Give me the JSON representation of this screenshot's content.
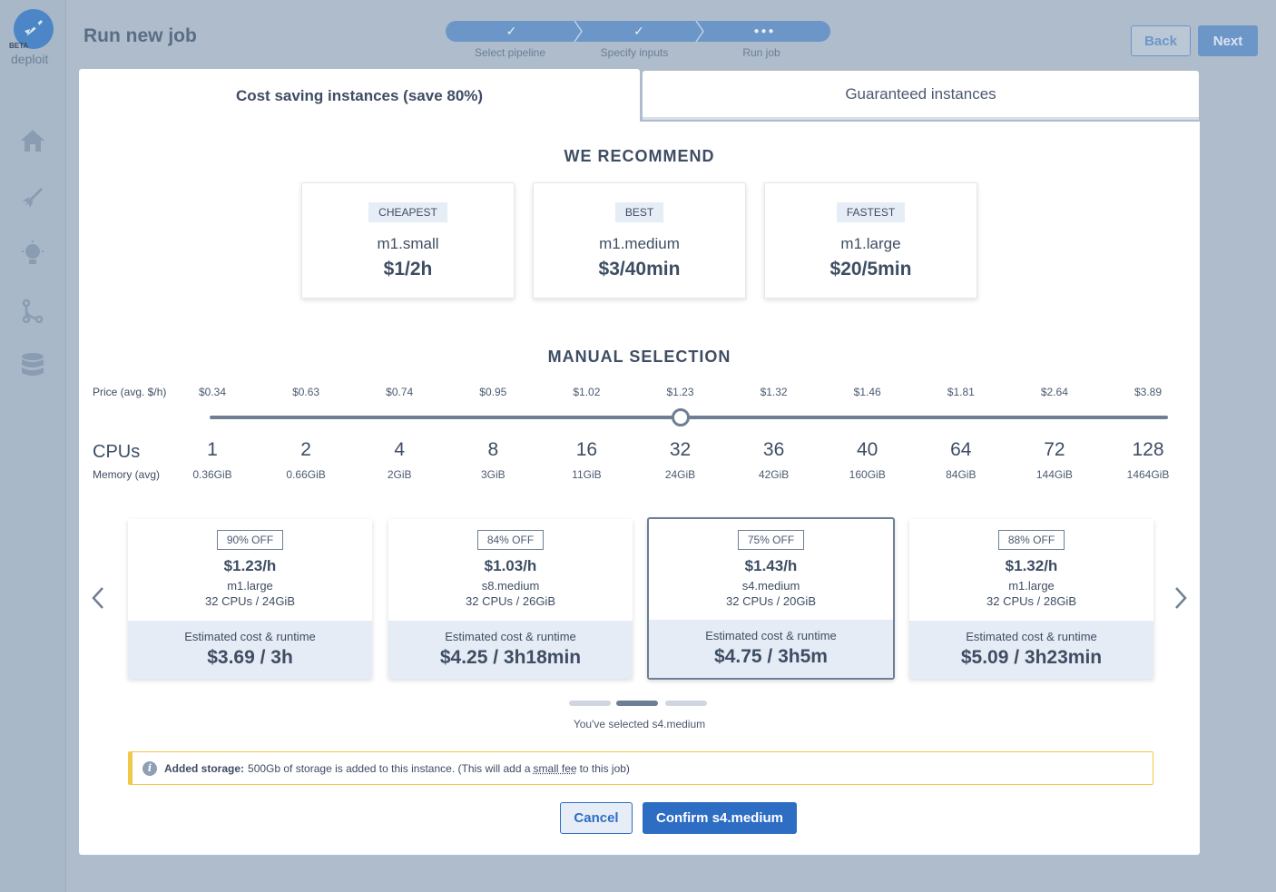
{
  "app": {
    "badge": "BETA",
    "name": "deploit"
  },
  "header": {
    "title": "Run new job",
    "steps": [
      {
        "label": "Select pipeline",
        "state": "done"
      },
      {
        "label": "Specify inputs",
        "state": "done"
      },
      {
        "label": "Run job",
        "state": "current"
      }
    ],
    "back_label": "Back",
    "next_label": "Next"
  },
  "tabs": [
    {
      "label": "Cost saving instances (save 80%)",
      "active": true
    },
    {
      "label": "Guaranteed instances",
      "active": false
    }
  ],
  "recommend": {
    "title": "WE RECOMMEND",
    "cards": [
      {
        "badge": "CHEAPEST",
        "name": "m1.small",
        "price": "$1/2h"
      },
      {
        "badge": "BEST",
        "name": "m1.medium",
        "price": "$3/40min"
      },
      {
        "badge": "FASTEST",
        "name": "m1.large",
        "price": "$20/5min"
      }
    ]
  },
  "manual": {
    "title": "MANUAL SELECTION",
    "price_label": "Price (avg. $/h)",
    "cpu_label": "CPUs",
    "memory_label": "Memory (avg)",
    "prices": [
      "$0.34",
      "$0.63",
      "$0.74",
      "$0.95",
      "$1.02",
      "$1.23",
      "$1.32",
      "$1.46",
      "$1.81",
      "$2.64",
      "$3.89"
    ],
    "cpus": [
      "1",
      "2",
      "4",
      "8",
      "16",
      "32",
      "36",
      "40",
      "64",
      "72",
      "128"
    ],
    "memory": [
      "0.36GiB",
      "0.66GiB",
      "2GiB",
      "3GiB",
      "11GiB",
      "24GiB",
      "42GiB",
      "160GiB",
      "84GiB",
      "144GiB",
      "1464GiB"
    ],
    "selected_index": 5
  },
  "instances": {
    "cards": [
      {
        "discount": "90% OFF",
        "price": "$1.23/h",
        "type": "m1.large",
        "spec": "32 CPUs / 24GiB",
        "est_label": "Estimated cost & runtime",
        "est": "$3.69 / 3h",
        "selected": false
      },
      {
        "discount": "84% OFF",
        "price": "$1.03/h",
        "type": "s8.medium",
        "spec": "32 CPUs / 26GiB",
        "est_label": "Estimated cost & runtime",
        "est": "$4.25 / 3h18min",
        "selected": false
      },
      {
        "discount": "75% OFF",
        "price": "$1.43/h",
        "type": "s4.medium",
        "spec": "32 CPUs / 20GiB",
        "est_label": "Estimated cost & runtime",
        "est": "$4.75 / 3h5m",
        "selected": true
      },
      {
        "discount": "88% OFF",
        "price": "$1.32/h",
        "type": "m1.large",
        "spec": "32 CPUs / 28GiB",
        "est_label": "Estimated cost & runtime",
        "est": "$5.09 / 3h23min",
        "selected": false
      }
    ],
    "page_count": 3,
    "active_page": 1,
    "selected_note": "You've selected s4.medium"
  },
  "alert": {
    "title": "Added storage:",
    "text_before": "500Gb of storage is added to this instance. (This will add a",
    "link": "small fee",
    "text_after": "to this job)"
  },
  "actions": {
    "cancel_label": "Cancel",
    "confirm_label": "Confirm s4.medium"
  },
  "colors": {
    "primary": "#2e6dc4",
    "accent_soft": "#6c96c7",
    "warning": "#f0c94a"
  }
}
